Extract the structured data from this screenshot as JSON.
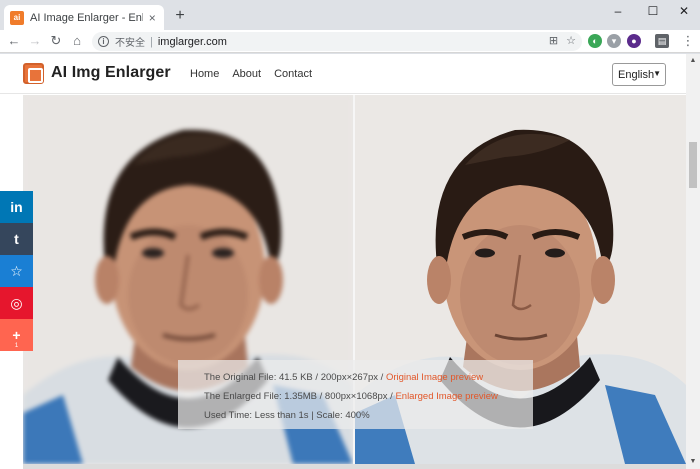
{
  "browser": {
    "tab_title": "AI Image Enlarger - Enlarge Im",
    "tab_close": "×",
    "new_tab": "+",
    "win_min": "–",
    "win_max": "☐",
    "win_close": "✕",
    "security_label": "不安全",
    "url": "imglarger.com"
  },
  "header": {
    "brand": "AI Img Enlarger",
    "nav": [
      "Home",
      "About",
      "Contact"
    ],
    "language": "English"
  },
  "share": {
    "buttons": [
      {
        "label": "in",
        "icon": "linkedin-icon",
        "color": "#0077b5"
      },
      {
        "label": "t",
        "icon": "tumblr-icon",
        "color": "#35465c"
      },
      {
        "label": "☆",
        "icon": "favorite-icon",
        "color": "#1a7fd4"
      },
      {
        "label": "◎",
        "icon": "weibo-icon",
        "color": "#e6162d"
      },
      {
        "label": "+",
        "icon": "more-share-icon",
        "color": "#ff6550",
        "count": "1"
      }
    ]
  },
  "info": {
    "original_text": "The Original File: 41.5 KB / 200px×267px / ",
    "original_link": "Original Image preview",
    "enlarged_text": "The Enlarged File: 1.35MB / 800px×1068px / ",
    "enlarged_link": "Enlarged Image preview",
    "used_time": "Used Time: Less than 1s | Scale: 400%"
  },
  "colors": {
    "accent": "#e2572a",
    "logo": "#e8733a"
  }
}
